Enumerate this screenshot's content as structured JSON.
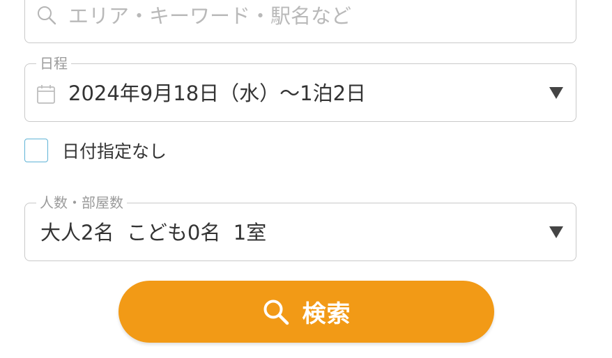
{
  "keyword": {
    "placeholder": "エリア・キーワード・駅名など",
    "value": ""
  },
  "schedule": {
    "legend": "日程",
    "value": "2024年9月18日（水）～1泊2日"
  },
  "no_date": {
    "label": "日付指定なし",
    "checked": false
  },
  "guests": {
    "legend": "人数・部屋数",
    "value": "大人2名  こども0名  1室"
  },
  "search_button": {
    "label": "検索"
  },
  "colors": {
    "accent": "#f29a16",
    "border": "#c9c9c9",
    "checkbox_border": "#5fb3d6",
    "placeholder": "#b9b9b9"
  },
  "icons": {
    "keyword": "search-icon",
    "schedule": "calendar-icon",
    "dropdown": "triangle-down-icon",
    "button": "search-icon"
  }
}
